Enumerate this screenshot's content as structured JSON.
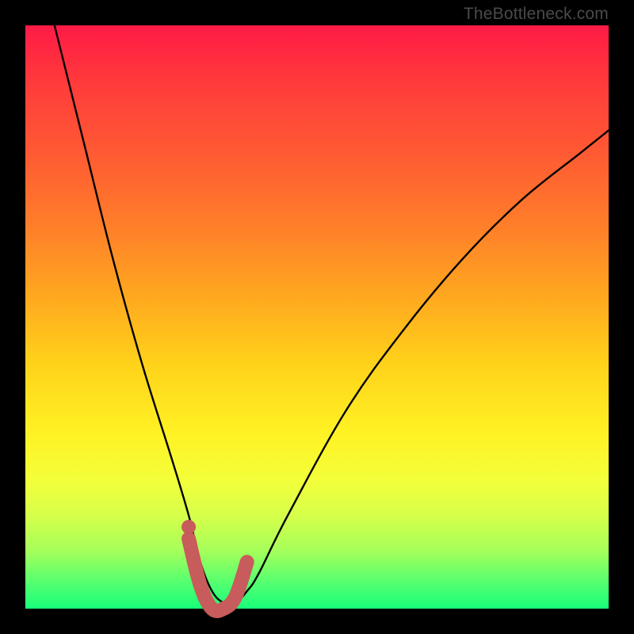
{
  "attribution": "TheBottleneck.com",
  "chart_data": {
    "type": "line",
    "title": "",
    "xlabel": "",
    "ylabel": "",
    "xlim": [
      0,
      100
    ],
    "ylim": [
      0,
      100
    ],
    "series": [
      {
        "name": "bottleneck-curve",
        "x": [
          5,
          10,
          15,
          20,
          25,
          28,
          30,
          32,
          34,
          36,
          38,
          40,
          45,
          55,
          65,
          75,
          85,
          95,
          100
        ],
        "values": [
          100,
          80,
          60,
          42,
          26,
          16,
          8,
          3,
          1,
          1,
          3,
          6,
          16,
          34,
          48,
          60,
          70,
          78,
          82
        ]
      }
    ],
    "marker": {
      "name": "selected-range-marker",
      "color": "#c85b5b",
      "x": [
        28,
        30,
        32,
        34,
        36,
        38
      ],
      "values": [
        12,
        4,
        0,
        0,
        2,
        8
      ]
    },
    "marker_dot": {
      "x": 28,
      "value": 14,
      "color": "#c85b5b"
    }
  }
}
